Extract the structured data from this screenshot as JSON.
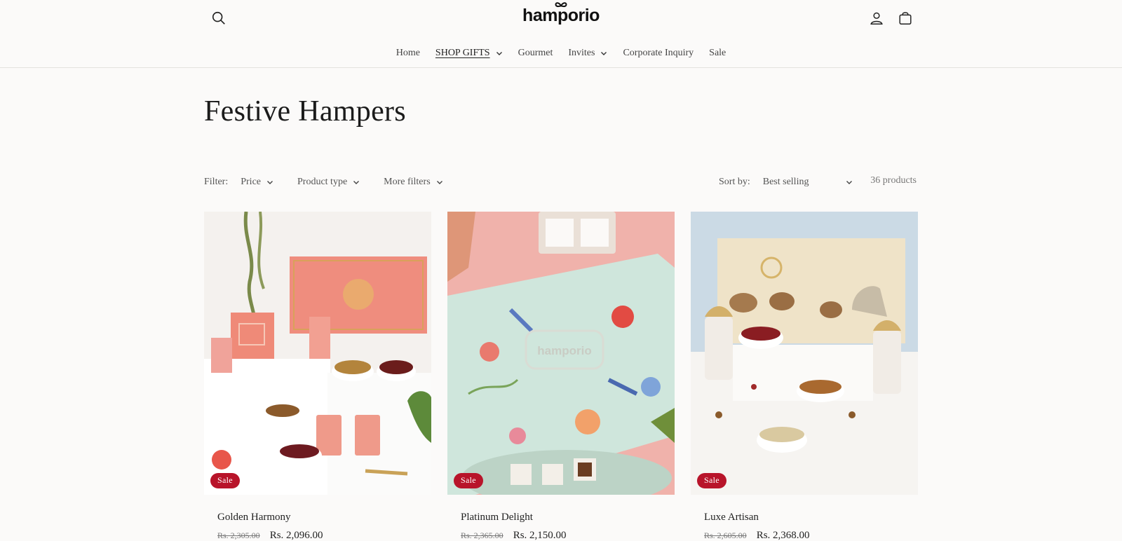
{
  "brand": {
    "logo_text": "hamporio"
  },
  "header": {
    "icons": [
      "search-icon",
      "account-icon",
      "cart-icon"
    ]
  },
  "nav": {
    "items": [
      {
        "label": "Home",
        "has_dropdown": false,
        "active": false
      },
      {
        "label": "SHOP GIFTS",
        "has_dropdown": true,
        "active": true
      },
      {
        "label": "Gourmet",
        "has_dropdown": false,
        "active": false
      },
      {
        "label": "Invites",
        "has_dropdown": true,
        "active": false
      },
      {
        "label": "Corporate Inquiry",
        "has_dropdown": false,
        "active": false
      },
      {
        "label": "Sale",
        "has_dropdown": false,
        "active": false
      }
    ]
  },
  "collection": {
    "title": "Festive Hampers"
  },
  "filters": {
    "label": "Filter:",
    "items": [
      "Price",
      "Product type",
      "More filters"
    ],
    "sort_label": "Sort by:",
    "sort_value": "Best selling",
    "product_count": "36 products"
  },
  "products": [
    {
      "title": "Golden Harmony",
      "badge": "Sale",
      "compare_price": "Rs. 2,305.00",
      "price": "Rs. 2,096.00"
    },
    {
      "title": "Platinum Delight",
      "badge": "Sale",
      "compare_price": "Rs. 2,365.00",
      "price": "Rs. 2,150.00"
    },
    {
      "title": "Luxe Artisan",
      "badge": "Sale",
      "compare_price": "Rs. 2,605.00",
      "price": "Rs. 2,368.00"
    }
  ],
  "colors": {
    "background": "#fbfaf9",
    "sale_badge": "#b8142a",
    "text": "#222222"
  }
}
